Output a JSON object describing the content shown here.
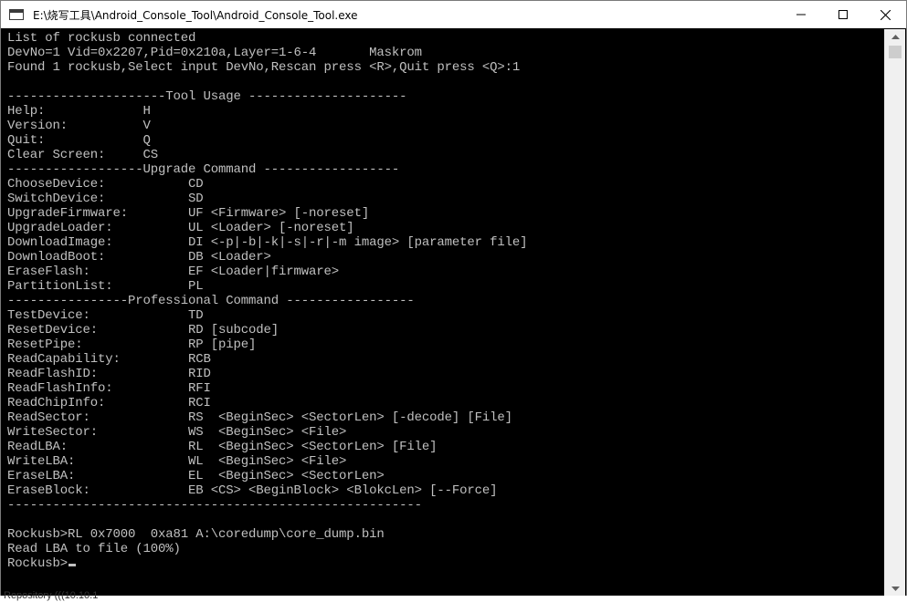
{
  "window": {
    "title": "E:\\烧写工具\\Android_Console_Tool\\Android_Console_Tool.exe",
    "controls": [
      "minimize-icon",
      "maximize-icon",
      "close-icon"
    ]
  },
  "console": {
    "lines": [
      "List of rockusb connected",
      "DevNo=1 Vid=0x2207,Pid=0x210a,Layer=1-6-4       Maskrom",
      "Found 1 rockusb,Select input DevNo,Rescan press <R>,Quit press <Q>:1",
      "",
      "---------------------Tool Usage ---------------------",
      "Help:             H",
      "Version:          V",
      "Quit:             Q",
      "Clear Screen:     CS",
      "------------------Upgrade Command ------------------",
      "ChooseDevice:           CD",
      "SwitchDevice:           SD",
      "UpgradeFirmware:        UF <Firmware> [-noreset]",
      "UpgradeLoader:          UL <Loader> [-noreset]",
      "DownloadImage:          DI <-p|-b|-k|-s|-r|-m image> [parameter file]",
      "DownloadBoot:           DB <Loader>",
      "EraseFlash:             EF <Loader|firmware>",
      "PartitionList:          PL",
      "----------------Professional Command -----------------",
      "TestDevice:             TD",
      "ResetDevice:            RD [subcode]",
      "ResetPipe:              RP [pipe]",
      "ReadCapability:         RCB",
      "ReadFlashID:            RID",
      "ReadFlashInfo:          RFI",
      "ReadChipInfo:           RCI",
      "ReadSector:             RS  <BeginSec> <SectorLen> [-decode] [File]",
      "WriteSector:            WS  <BeginSec> <File>",
      "ReadLBA:                RL  <BeginSec> <SectorLen> [File]",
      "WriteLBA:               WL  <BeginSec> <File>",
      "EraseLBA:               EL  <BeginSec> <SectorLen>",
      "EraseBlock:             EB <CS> <BeginBlock> <BlokcLen> [--Force]",
      "-------------------------------------------------------",
      "",
      "Rockusb>RL 0x7000  0xa81 A:\\coredump\\core_dump.bin",
      "Read LBA to file (100%)"
    ],
    "prompt": "Rockusb>"
  },
  "background_hint": "Repository (((10.10.1"
}
